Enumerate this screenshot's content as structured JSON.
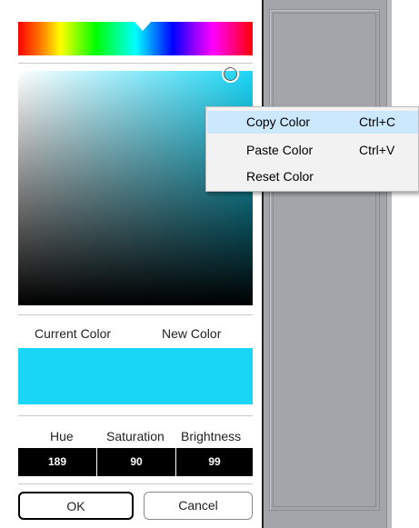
{
  "colors": {
    "current_color": "#19d6f7",
    "new_color": "#19d6f7",
    "hue_gradient": "rainbow"
  },
  "picker": {
    "current_color_label": "Current Color",
    "new_color_label": "New Color",
    "hue_label": "Hue",
    "saturation_label": "Saturation",
    "brightness_label": "Brightness",
    "hue_value": "189",
    "saturation_value": "90",
    "brightness_value": "99",
    "ok_label": "OK",
    "cancel_label": "Cancel"
  },
  "context_menu": {
    "items": [
      {
        "label": "Copy Color",
        "shortcut": "Ctrl+C",
        "highlighted": true
      },
      {
        "label": "Paste Color",
        "shortcut": "Ctrl+V",
        "highlighted": false
      },
      {
        "label": "Reset Color",
        "shortcut": "",
        "highlighted": false
      }
    ]
  }
}
